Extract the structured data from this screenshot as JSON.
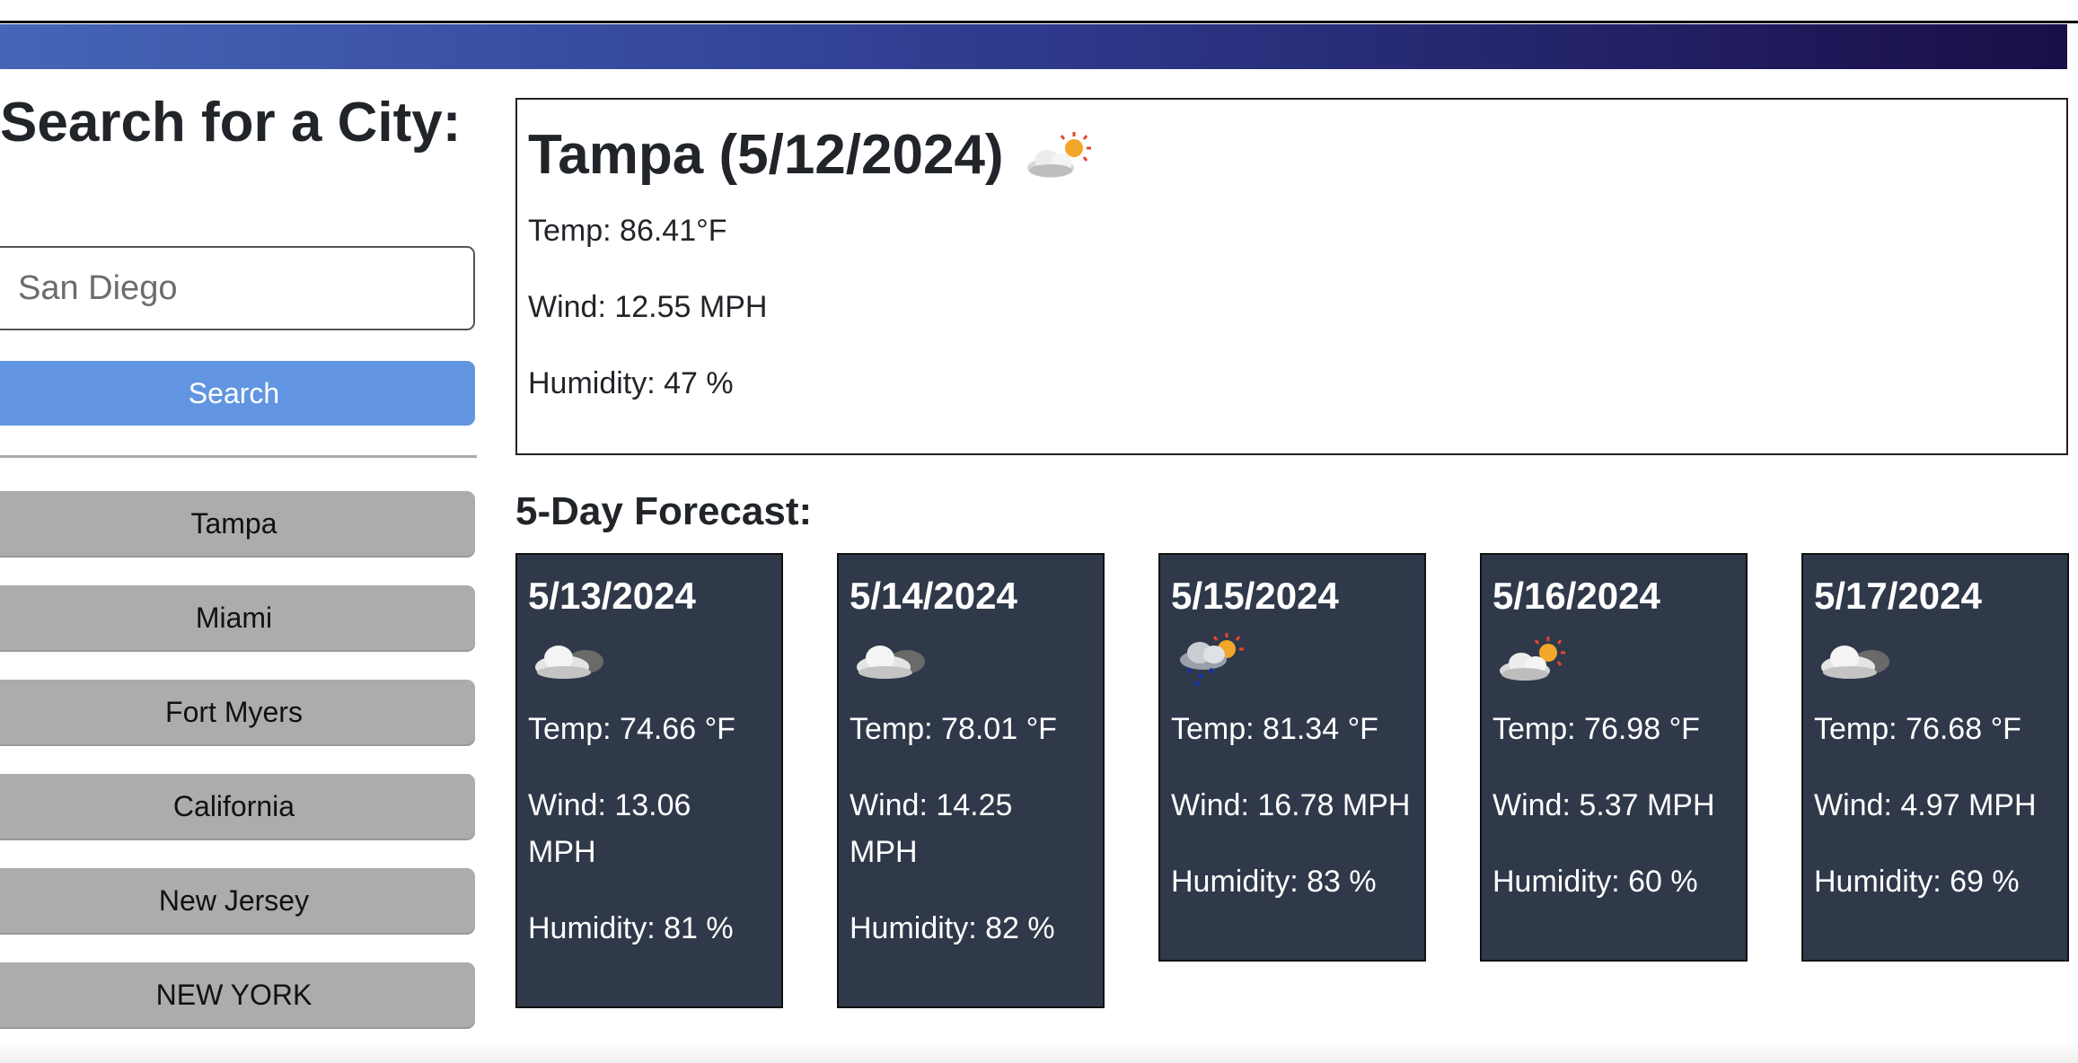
{
  "sidebar": {
    "title": "Search for a City:",
    "search_placeholder": "San Diego",
    "search_button": "Search",
    "history": [
      "Tampa",
      "Miami",
      "Fort Myers",
      "California",
      "New Jersey",
      "NEW YORK"
    ]
  },
  "current": {
    "heading": "Tampa (5/12/2024)",
    "icon": "partly-cloudy-sun-icon",
    "temp": "Temp: 86.41°F",
    "wind": "Wind: 12.55 MPH",
    "humidity": "Humidity: 47 %"
  },
  "forecast": {
    "title": "5-Day Forecast:",
    "days": [
      {
        "date": "5/13/2024",
        "icon": "overcast-cloud-icon",
        "temp": "Temp: 74.66 °F",
        "wind": "Wind: 13.06 MPH",
        "humidity": "Humidity: 81 %"
      },
      {
        "date": "5/14/2024",
        "icon": "overcast-cloud-icon",
        "temp": "Temp: 78.01 °F",
        "wind": "Wind: 14.25 MPH",
        "humidity": "Humidity: 82 %"
      },
      {
        "date": "5/15/2024",
        "icon": "rain-sun-icon",
        "temp": "Temp: 81.34 °F",
        "wind": "Wind: 16.78 MPH",
        "humidity": "Humidity: 83 %"
      },
      {
        "date": "5/16/2024",
        "icon": "partly-cloudy-sun-icon",
        "temp": "Temp: 76.98 °F",
        "wind": "Wind: 5.37 MPH",
        "humidity": "Humidity: 60 %"
      },
      {
        "date": "5/17/2024",
        "icon": "overcast-cloud-icon",
        "temp": "Temp: 76.68 °F",
        "wind": "Wind: 4.97 MPH",
        "humidity": "Humidity: 69 %"
      }
    ]
  },
  "colors": {
    "banner_start": "#4565b8",
    "banner_end": "#1a0e48",
    "search_button": "#6295e1",
    "history_button": "#acacac",
    "card_background": "#30394a"
  }
}
